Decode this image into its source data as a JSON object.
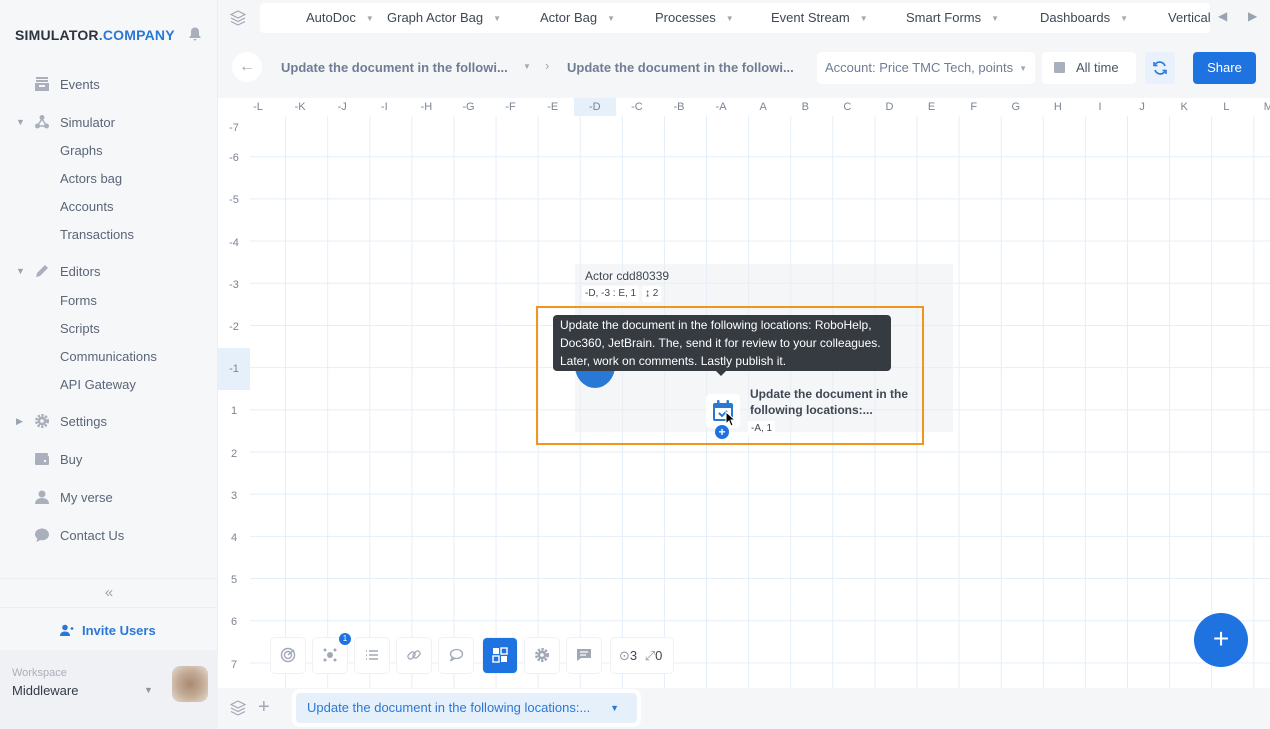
{
  "brand": {
    "name": "SIMULATOR",
    "suffix": ".COMPANY"
  },
  "sidebar": {
    "items": [
      {
        "label": "Events",
        "icon": "events-icon"
      },
      {
        "label": "Simulator",
        "icon": "simulator-icon",
        "expanded": true,
        "children": [
          "Graphs",
          "Actors bag",
          "Accounts",
          "Transactions"
        ]
      },
      {
        "label": "Editors",
        "icon": "pencil-icon",
        "expanded": true,
        "children": [
          "Forms",
          "Scripts",
          "Communications",
          "API Gateway"
        ]
      },
      {
        "label": "Settings",
        "icon": "gear-icon",
        "expanded": false
      },
      {
        "label": "Buy",
        "icon": "wallet-icon"
      },
      {
        "label": "My verse",
        "icon": "user-icon"
      },
      {
        "label": "Contact Us",
        "icon": "chat-icon"
      }
    ],
    "collapse_label": "«",
    "invite_label": "Invite Users",
    "workspace": {
      "label": "Workspace",
      "value": "Middleware"
    }
  },
  "tabs": [
    "AutoDoc",
    "Graph Actor Bag",
    "Actor Bag",
    "Processes",
    "Event Stream",
    "Smart Forms",
    "Dashboards",
    "Vertical"
  ],
  "header": {
    "breadcrumb": [
      "Update the document in the followi...",
      "Update the document in the followi..."
    ],
    "account_select": "Account: Price TMC Tech, points",
    "time_filter": "All time",
    "share_label": "Share"
  },
  "grid": {
    "columns": [
      "-L",
      "-K",
      "-J",
      "-I",
      "-H",
      "-G",
      "-F",
      "-E",
      "-D",
      "-C",
      "-B",
      "-A",
      "A",
      "B",
      "C",
      "D",
      "E",
      "F",
      "G",
      "H",
      "I",
      "J",
      "K",
      "L",
      "M"
    ],
    "rows": [
      "-7",
      "-6",
      "-5",
      "-4",
      "-3",
      "-2",
      "-1",
      "1",
      "2",
      "3",
      "4",
      "5",
      "6",
      "7"
    ],
    "highlight_column": "-D",
    "highlight_row": "-1"
  },
  "actor": {
    "title": "Actor cdd80339",
    "range": "-D, -3 : E, 1",
    "count": "↨ 2"
  },
  "node": {
    "label": "Update the document in the following locations:...",
    "coord": "-A, 1",
    "tooltip": "Update the document in the following locations: RoboHelp, Doc360, JetBrain. The, send it for review to your colleagues. Later, work on comments. Lastly publish it."
  },
  "toolbar": {
    "badge_count": "1",
    "nodes_count": "3",
    "links_count": "0"
  },
  "footer": {
    "active_tab": "Update the document in the following locations:..."
  }
}
